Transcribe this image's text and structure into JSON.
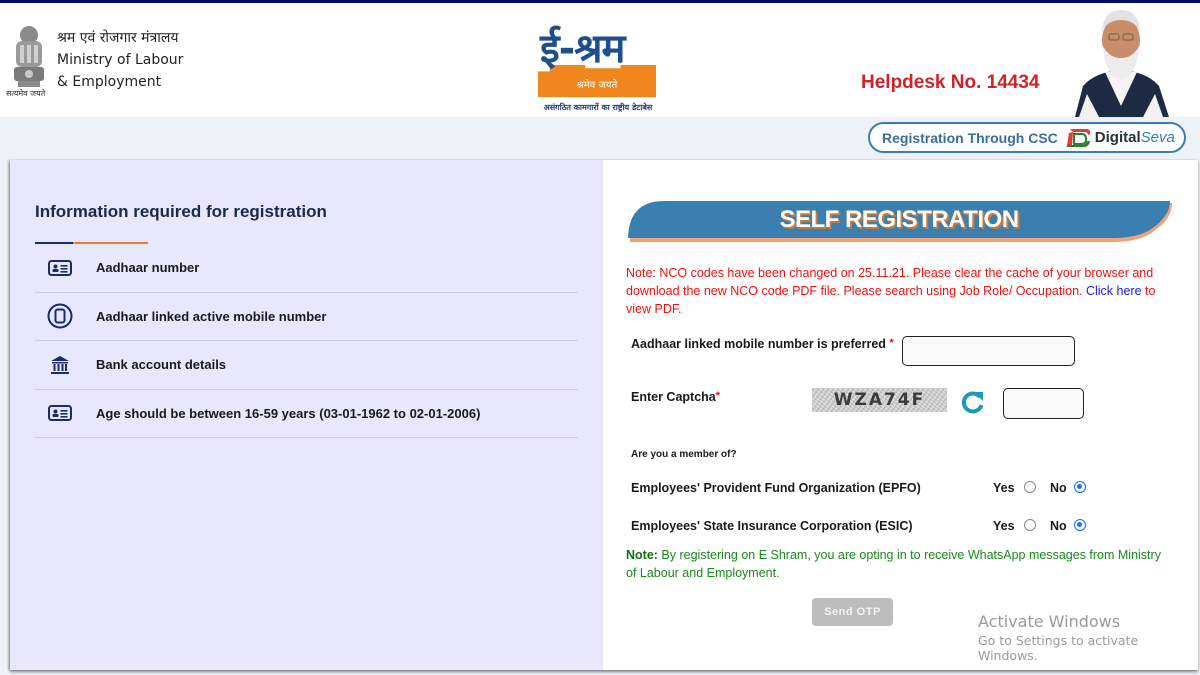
{
  "header": {
    "emblem_caption": "सत्यमेव जयते",
    "ministry_hindi": "श्रम एवं रोजगार मंत्रालय",
    "ministry_line1": "Ministry of Labour",
    "ministry_line2": "& Employment",
    "logo_title": "ई-श्रम",
    "logo_tagline": "श्रमेव जयते",
    "logo_subtitle": "असंगठित कामगारों का राष्ट्रीय डेटाबेस",
    "helpdesk": "Helpdesk No. 14434",
    "csc_label": "Registration Through CSC",
    "csc_brand_digital": "Digital",
    "csc_brand_seva": "Seva"
  },
  "left_panel": {
    "title": "Information required for registration",
    "items": [
      {
        "icon": "id-card-icon",
        "label": "Aadhaar number"
      },
      {
        "icon": "mobile-phone-icon",
        "label": "Aadhaar linked active mobile number"
      },
      {
        "icon": "bank-icon",
        "label": "Bank account details"
      },
      {
        "icon": "id-card-icon",
        "label": "Age should be between 16-59 years (03-01-1962 to 02-01-2006)"
      }
    ]
  },
  "right_panel": {
    "banner": "SELF REGISTRATION",
    "nco_note_text": "Note: NCO codes have been changed on 25.11.21. Please clear the cache of your browser and download the new NCO code PDF file. Please search using Job Role/ Occupation. ",
    "nco_note_link": "Click here",
    "nco_note_suffix": " to view PDF.",
    "mobile_label": "Aadhaar linked mobile number is preferred",
    "mobile_value": "",
    "captcha_label": "Enter Captcha",
    "captcha_text": "WZA74F",
    "captcha_value": "",
    "required_mark": "*",
    "member_question": "Are you a member of?",
    "memberships": [
      {
        "org": "Employees' Provident Fund Organization (EPFO)",
        "yes_label": "Yes",
        "no_label": "No",
        "selected": "No"
      },
      {
        "org": "Employees' State Insurance Corporation (ESIC)",
        "yes_label": "Yes",
        "no_label": "No",
        "selected": "No"
      }
    ],
    "wa_note_bold": "Note:",
    "wa_note_text": " By registering on E Shram, you are opting in to receive WhatsApp messages from Ministry of Labour and Employment.",
    "send_otp": "Send OTP"
  },
  "watermark": {
    "line1": "Activate Windows",
    "line2": "Go to Settings to activate Windows."
  },
  "colors": {
    "banner_blue": "#3a7fb0",
    "helpdesk_red": "#d42027",
    "note_red": "#ee1111",
    "note_green": "#1a8a1a",
    "panel_lavender": "#e7e7fd",
    "logo_orange": "#f0871d",
    "logo_blue": "#1f4e8c"
  }
}
